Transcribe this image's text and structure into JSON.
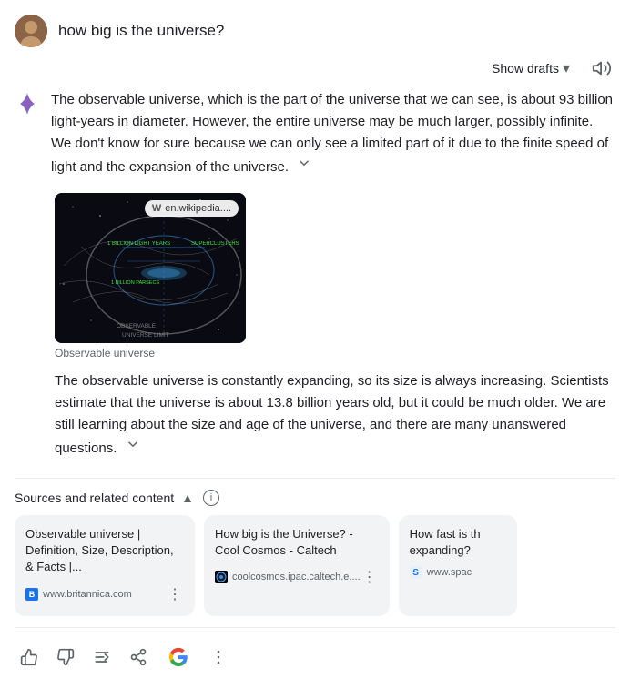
{
  "header": {
    "query": "how big is the universe?",
    "avatar_alt": "User avatar"
  },
  "controls": {
    "show_drafts_label": "Show drafts",
    "speaker_icon": "speaker-icon"
  },
  "response": {
    "paragraph1": "The observable universe, which is the part of the universe that we can see, is about 93 billion light-years in diameter. However, the entire universe may be much larger, possibly infinite. We don't know for sure because we can only see a limited part of it due to the finite speed of light and the expansion of the universe.",
    "paragraph2": "The observable universe is constantly expanding, so its size is always increasing. Scientists estimate that the universe is about 13.8 billion years old, but it could be much older. We are still learning about the size and age of the universe, and there are many unanswered questions.",
    "image_caption": "Observable universe",
    "wiki_badge": "en.wikipedia...."
  },
  "sources": {
    "label": "Sources and related content",
    "info_icon": "ⓘ",
    "cards": [
      {
        "title": "Observable universe | Definition, Size, Description, & Facts |...",
        "site": "www.britannica.com",
        "favicon_type": "britannica"
      },
      {
        "title": "How big is the Universe? - Cool Cosmos - Caltech",
        "site": "coolcosmos.ipac.caltech.e....",
        "favicon_type": "coolcosmos"
      },
      {
        "title": "How fast is th expanding?",
        "site": "www.spac",
        "favicon_type": "space"
      }
    ]
  },
  "actions": {
    "thumbs_up": "👍",
    "thumbs_down": "👎",
    "recycle": "⇄",
    "share": "↗",
    "google_g": "G",
    "more": "⋮"
  }
}
